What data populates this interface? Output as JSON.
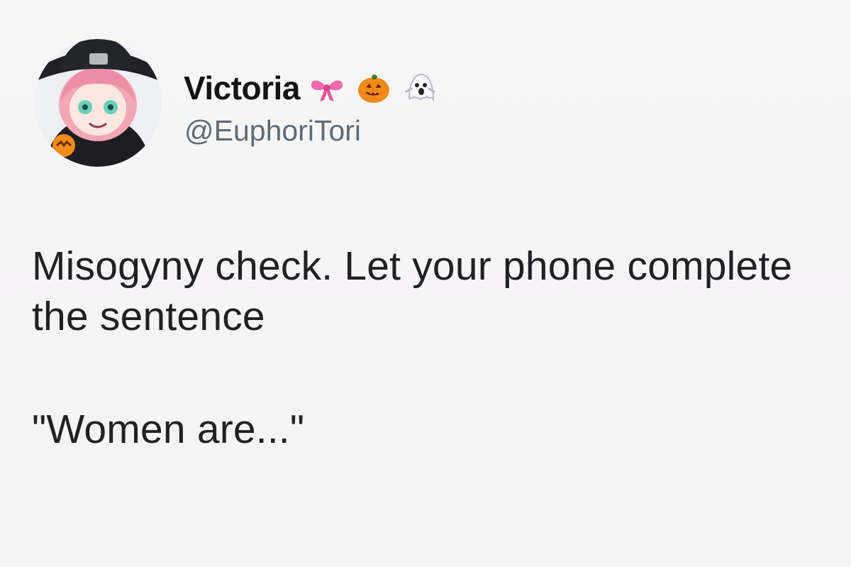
{
  "tweet": {
    "author": {
      "display_name": "Victoria",
      "handle": "@EuphoriTori",
      "name_emojis": [
        "bow-icon",
        "jack-o-lantern-icon",
        "ghost-icon"
      ],
      "avatar_icon": "anime-witch-avatar-icon"
    },
    "text_line_1": "Misogyny check. Let your phone complete the sentence",
    "text_line_2": "\"Women are...\""
  },
  "colors": {
    "background": "#f6f5f6",
    "text": "#202123",
    "handle": "#5f6b75",
    "bow": "#f06aa9",
    "pumpkin": "#f28a1a"
  }
}
